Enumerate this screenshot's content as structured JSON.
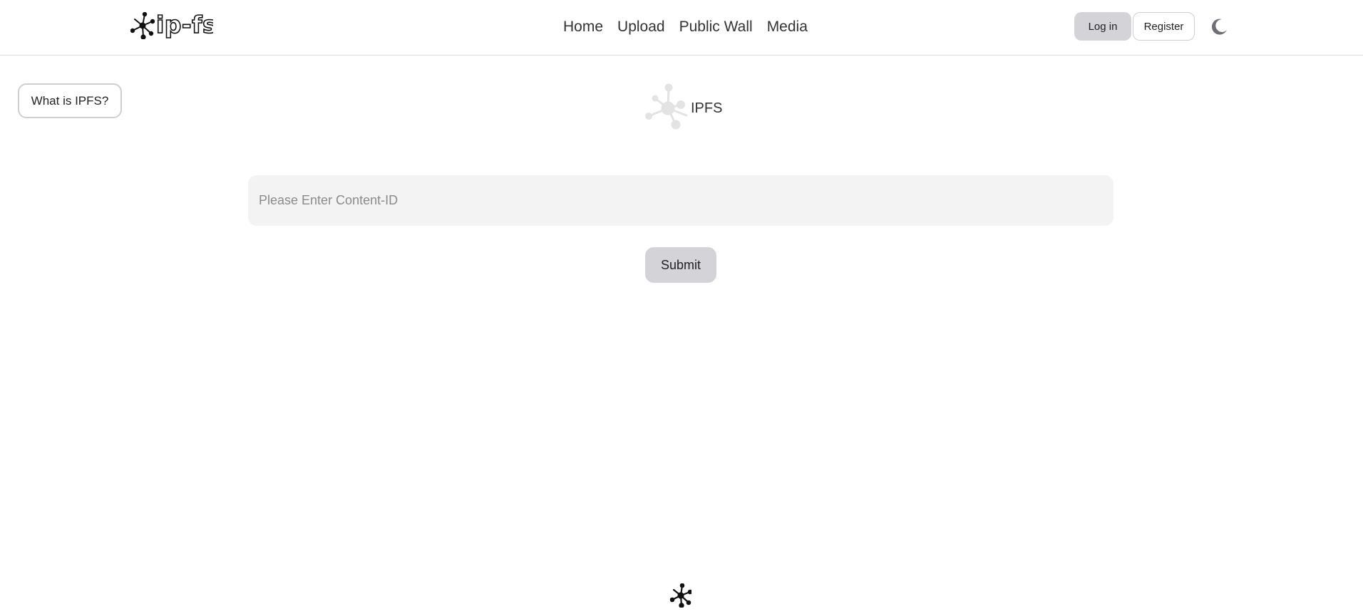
{
  "header": {
    "brand_text": "ip-fs",
    "nav": [
      {
        "label": "Home"
      },
      {
        "label": "Upload"
      },
      {
        "label": "Public Wall"
      },
      {
        "label": "Media"
      }
    ],
    "login_label": "Log in",
    "register_label": "Register",
    "theme_icon": "moon-icon"
  },
  "side": {
    "what_is_label": "What is IPFS?"
  },
  "hero": {
    "label": "IPFS",
    "icon": "ipfs-network-icon"
  },
  "form": {
    "placeholder": "Please Enter Content-ID",
    "value": "",
    "submit_label": "Submit"
  },
  "footer": {
    "icon": "ipfs-logo-icon"
  },
  "colors": {
    "button_gray": "#d3d3d8",
    "input_bg": "#f3f3f3",
    "border": "#dcdcdc",
    "hero_icon": "#e3e3e3",
    "moon": "#6f6e78"
  }
}
